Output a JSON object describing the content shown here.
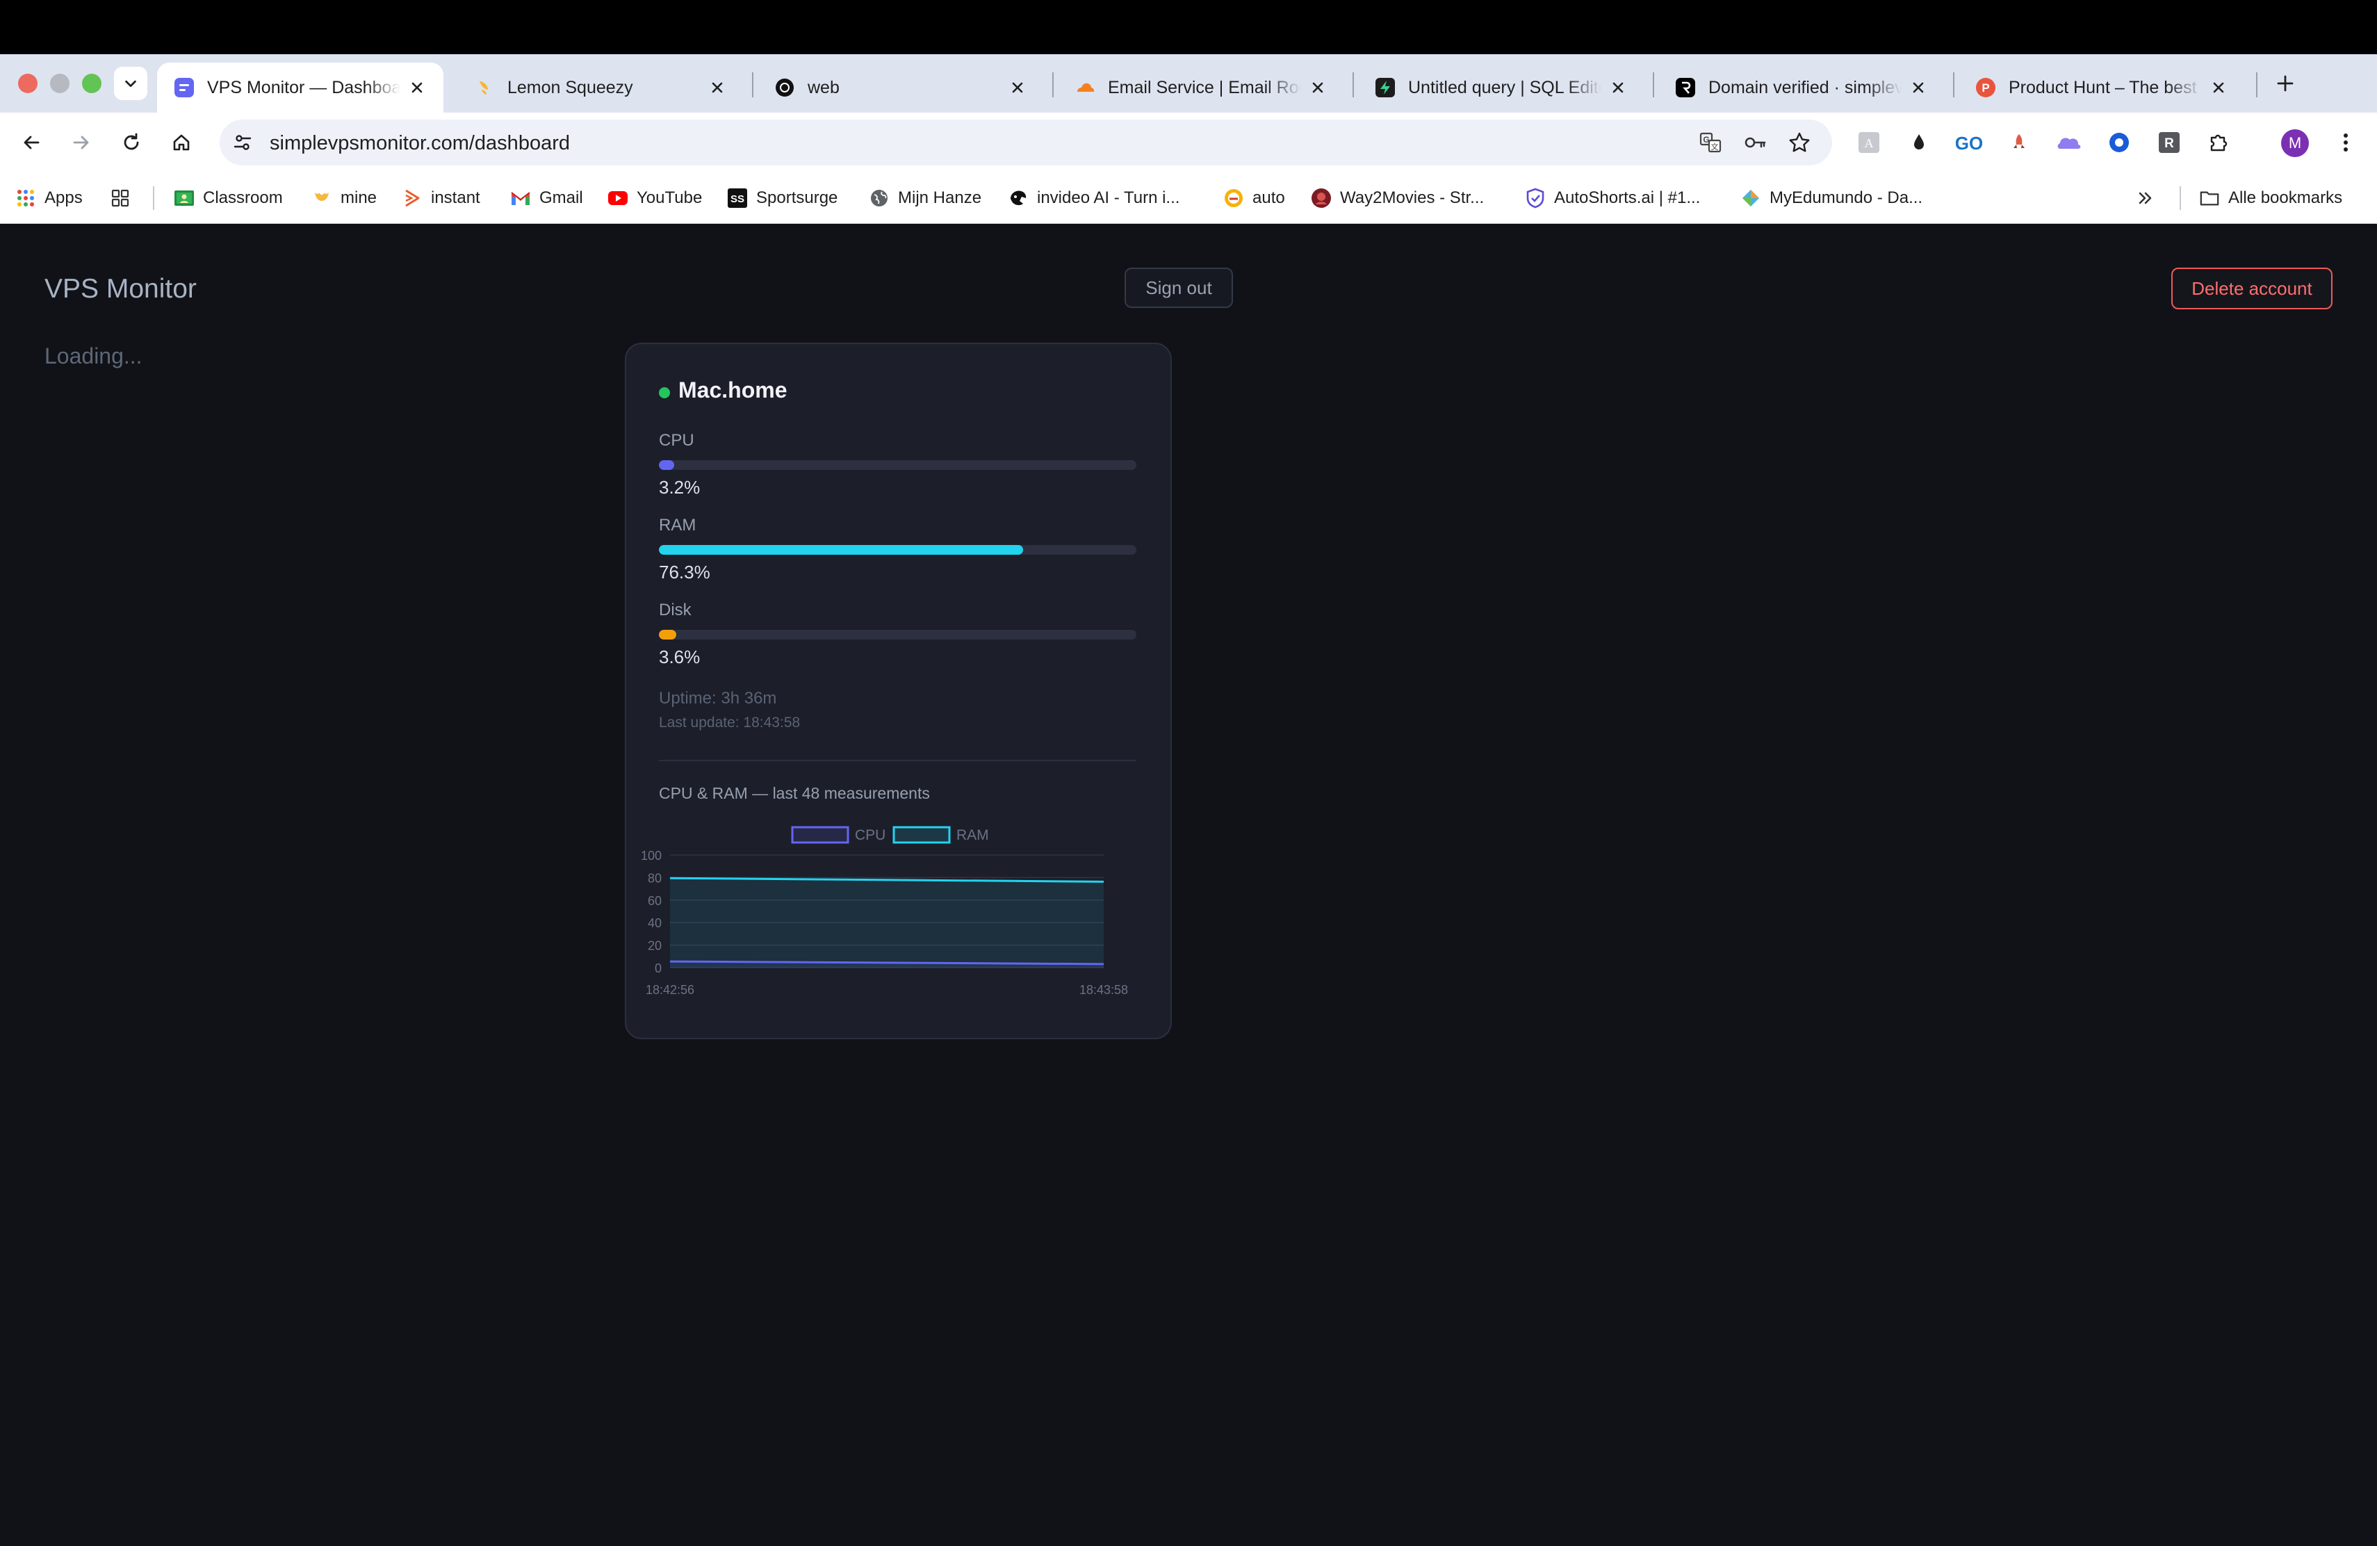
{
  "browser": {
    "tabs": [
      {
        "title": "VPS Monitor — Dashboard",
        "icon": "vps-monitor-favicon",
        "active": true
      },
      {
        "title": "Lemon Squeezy",
        "icon": "lemon-squeezy-favicon"
      },
      {
        "title": "web",
        "icon": "web-favicon"
      },
      {
        "title": "Email Service | Email Routing",
        "icon": "cloudflare-favicon"
      },
      {
        "title": "Untitled query | SQL Editor",
        "icon": "supabase-favicon"
      },
      {
        "title": "Domain verified · simplevps",
        "icon": "resend-favicon"
      },
      {
        "title": "Product Hunt – The best new products",
        "icon": "product-hunt-favicon"
      }
    ],
    "url": "simplevpsmonitor.com/dashboard",
    "profile_initial": "M",
    "bookmarks": [
      {
        "label": "Apps",
        "icon": "apps-grid-icon"
      },
      {
        "label": "",
        "icon": "tab-groups-icon"
      },
      {
        "label": "Classroom",
        "icon": "classroom-icon"
      },
      {
        "label": "mine",
        "icon": "mine-icon"
      },
      {
        "label": "instant",
        "icon": "instant-icon"
      },
      {
        "label": "Gmail",
        "icon": "gmail-icon"
      },
      {
        "label": "YouTube",
        "icon": "youtube-icon"
      },
      {
        "label": "Sportsurge",
        "icon": "sportsurge-icon"
      },
      {
        "label": "Mijn Hanze",
        "icon": "globe-icon"
      },
      {
        "label": "invideo AI - Turn i...",
        "icon": "invideo-icon"
      },
      {
        "label": "auto",
        "icon": "auto-icon"
      },
      {
        "label": "Way2Movies - Str...",
        "icon": "way2movies-icon"
      },
      {
        "label": "AutoShorts.ai | #1...",
        "icon": "autoshorts-icon"
      },
      {
        "label": "MyEdumundo - Da...",
        "icon": "myedumundo-icon"
      }
    ],
    "all_bookmarks_label": "Alle bookmarks"
  },
  "app": {
    "title": "VPS Monitor",
    "loading": "Loading...",
    "sign_out": "Sign out",
    "delete_account": "Delete account"
  },
  "server": {
    "hostname": "Mac.home",
    "status_color": "#22c55e",
    "metrics": [
      {
        "label": "CPU",
        "value": 3.2,
        "display": "3.2%",
        "color": "#6366f1"
      },
      {
        "label": "RAM",
        "value": 76.3,
        "display": "76.3%",
        "color": "#22d3ee"
      },
      {
        "label": "Disk",
        "value": 3.6,
        "display": "3.6%",
        "color": "#f59e0b"
      }
    ],
    "uptime": "Uptime: 3h 36m",
    "last_update": "Last update: 18:43:58"
  },
  "chart_data": {
    "type": "line",
    "title": "CPU & RAM — last 48 measurements",
    "x": [
      "18:42:56",
      "18:43:58"
    ],
    "series": [
      {
        "name": "CPU",
        "values": [
          5.5,
          3.2
        ],
        "color": "#6366f1"
      },
      {
        "name": "RAM",
        "values": [
          79.5,
          76.3
        ],
        "color": "#22d3ee"
      }
    ],
    "ylim": [
      0,
      100
    ],
    "yticks": [
      0,
      20,
      40,
      60,
      80,
      100
    ],
    "grid": true,
    "legend": "top-center"
  }
}
